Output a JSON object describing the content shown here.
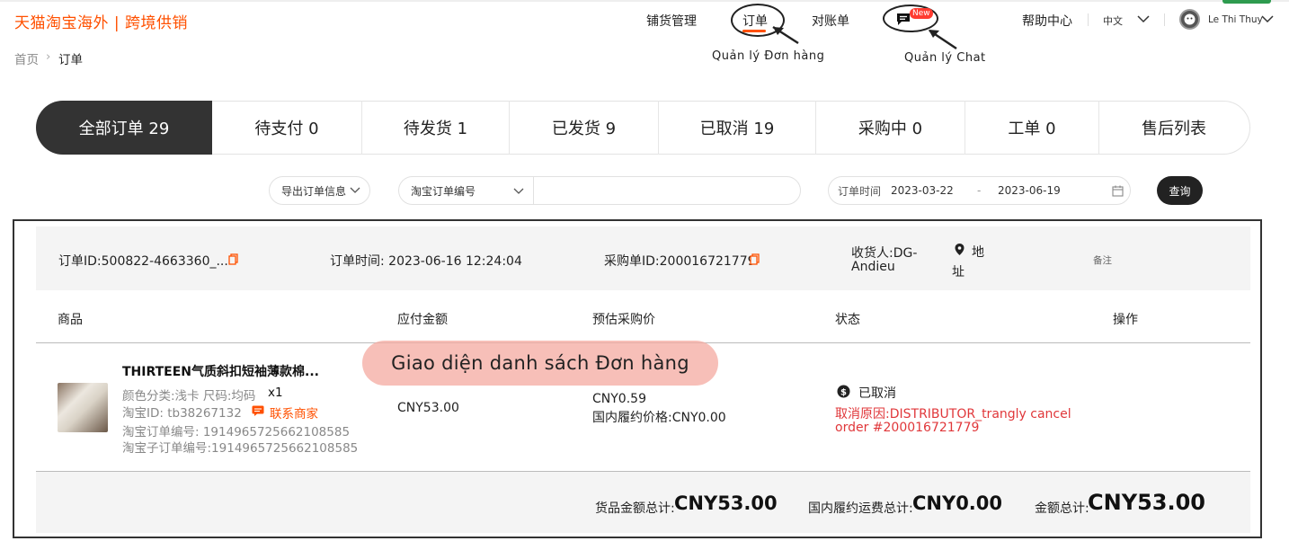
{
  "header": {
    "logo": "天猫淘宝海外 | 跨境供销",
    "nav": [
      {
        "label": "铺货管理"
      },
      {
        "label": "订单"
      },
      {
        "label": "对账单"
      }
    ],
    "chat_badge": "New",
    "help": "帮助中心",
    "language": "中文",
    "user": "Le Thi Thuy"
  },
  "annotations": {
    "orders": "Quản lý Đơn hàng",
    "chat": "Quản lý Chat",
    "list": "Giao diện danh sách Đơn hàng"
  },
  "breadcrumb": {
    "home": "首页",
    "sep": "›",
    "current": "订单"
  },
  "tabs": [
    {
      "label": "全部订单 29"
    },
    {
      "label": "待支付 0"
    },
    {
      "label": "待发货 1"
    },
    {
      "label": "已发货 9"
    },
    {
      "label": "已取消 19"
    },
    {
      "label": "采购中 0"
    },
    {
      "label": "工单 0"
    },
    {
      "label": "售后列表"
    }
  ],
  "filters": {
    "export_label": "导出订单信息",
    "search_type": "淘宝订单编号",
    "search_value": "",
    "date_label": "订单时间",
    "date_from": "2023-03-22",
    "date_sep": "-",
    "date_to": "2023-06-19",
    "query_button": "查询"
  },
  "order": {
    "id_label": "订单ID:500822-4663360_...",
    "time_label": "订单时间: 2023-06-16 12:24:04",
    "purchase_id_label": "采购单ID:200016721779",
    "receiver_line1": "收货人:DG-",
    "receiver_line2": "Andieu",
    "address_line1": "地",
    "address_line2": "址",
    "remark": "备注",
    "columns": [
      "商品",
      "应付金额",
      "预估采购价",
      "状态",
      "操作"
    ],
    "product": {
      "title": "THIRTEEN气质斜扣短袖薄款棉...",
      "variant": "颜色分类:浅卡 尺码:均码",
      "qty": "x1",
      "taobao_id": "淘宝ID: tb38267132",
      "contact": "联系商家",
      "order_no": "淘宝订单编号: 1914965725662108585",
      "sub_order_no": "淘宝子订单编号:1914965725662108585"
    },
    "payable": "CNY53.00",
    "est_price": "CNY0.59",
    "domestic_price": "国内履约价格:CNY0.00",
    "status": "已取消",
    "cancel_reason_line1": "取消原因:DISTRIBUTOR_trangly cancel",
    "cancel_reason_line2": "order #200016721779",
    "totals": {
      "goods_label": "货品金额总计:",
      "goods_value": "CNY53.00",
      "shipping_label": "国内履约运费总计:",
      "shipping_value": "CNY0.00",
      "total_label": "金额总计:",
      "total_value": "CNY53.00"
    }
  },
  "colors": {
    "brand": "#ff5000",
    "dark": "#333333",
    "cancel": "#e0373a",
    "overlay": "#f4aaa0"
  }
}
